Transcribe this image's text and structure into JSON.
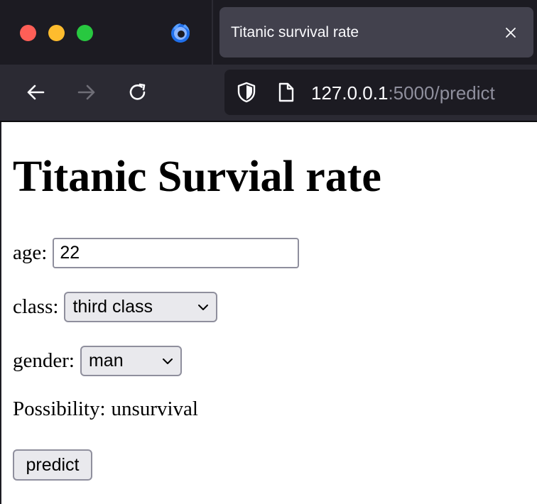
{
  "browser": {
    "tab_title": "Titanic survival rate",
    "url_host": "127.0.0.1",
    "url_rest": ":5000/predict"
  },
  "page": {
    "heading": "Titanic Survial rate",
    "age": {
      "label": "age:",
      "value": "22"
    },
    "class": {
      "label": "class:",
      "selected": "third class"
    },
    "gender": {
      "label": "gender:",
      "selected": "man"
    },
    "result": {
      "label": "Possibility:",
      "value": "unsurvival"
    },
    "predict_button": "predict"
  },
  "colors": {
    "chrome_dark": "#1c1b22",
    "toolbar": "#2b2a33",
    "tab_active": "#42414d",
    "close": "#ff5f57",
    "minimize": "#febc2e",
    "maximize": "#28c840"
  },
  "icons": {
    "back": "arrow-left-icon",
    "forward": "arrow-right-icon",
    "reload": "reload-icon",
    "security": "shield-icon",
    "page": "document-icon",
    "tab_close": "close-icon",
    "browser": "firefox-icon",
    "select": "chevron-down-icon"
  }
}
